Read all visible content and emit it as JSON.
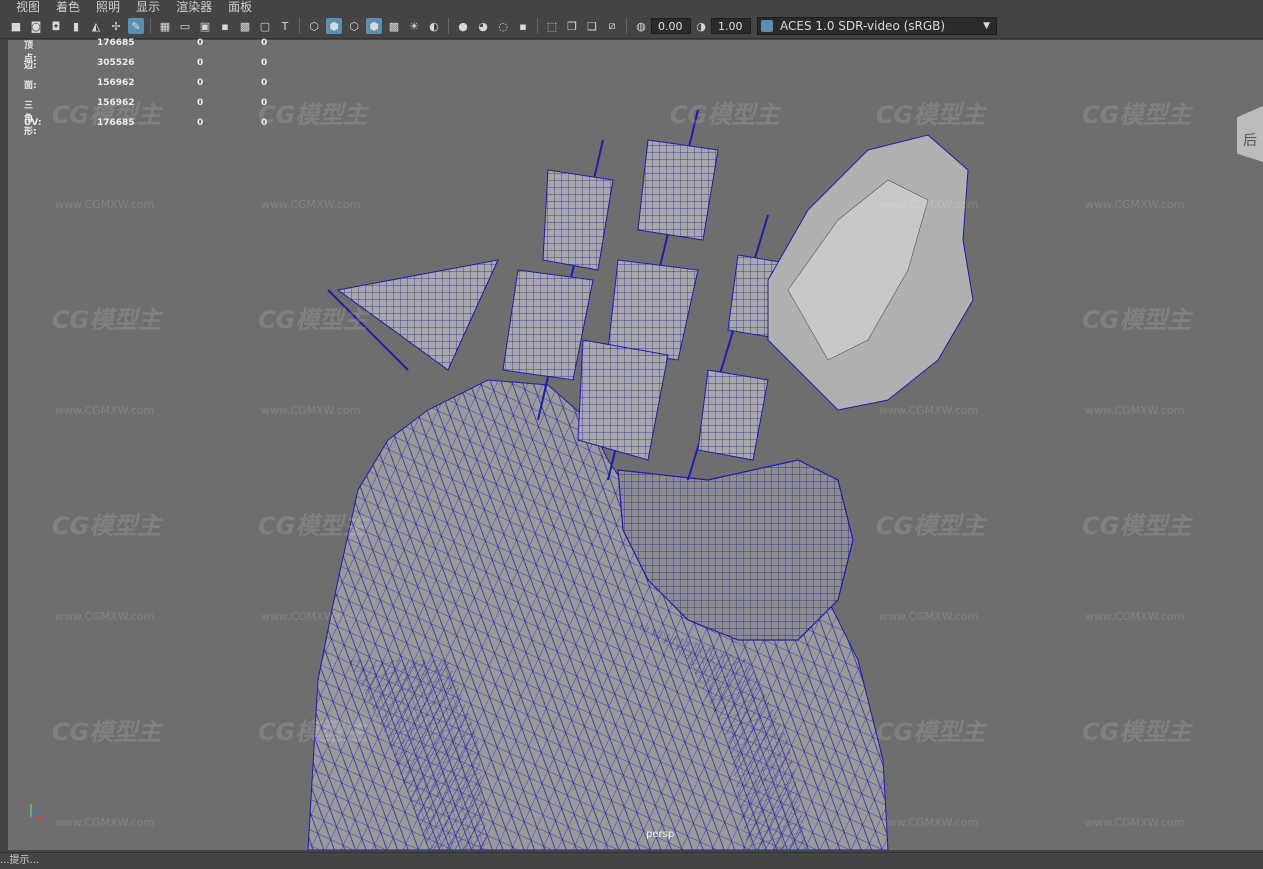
{
  "menu": [
    "视图",
    "着色",
    "照明",
    "显示",
    "渲染器",
    "面板"
  ],
  "toolbar": {
    "icons_group1": [
      "camera-icon",
      "camera-attr-icon",
      "bookmark-icon",
      "image-plane-icon",
      "grid-transform-icon",
      "pencil-icon"
    ],
    "icons_group2": [
      "grid-icon",
      "film-gate-icon",
      "resolution-gate-icon",
      "gate-mask-icon",
      "field-chart-icon",
      "safe-action-icon",
      "safe-title-icon"
    ],
    "icons_group3": [
      "wireframe-icon",
      "smooth-shade-icon",
      "wireframe-on-shaded-icon",
      "xray-icon",
      "textured-icon",
      "lighting-icon",
      "shadows-icon"
    ],
    "icons_group4": [
      "ambient-occlusion-icon",
      "motion-blur-icon",
      "multisample-icon",
      "depth-of-field-icon"
    ],
    "icons_group5": [
      "isolate-select-icon",
      "xray-joints-icon",
      "xray-active-icon",
      "backface-icon"
    ],
    "exposure_value": "0.00",
    "gamma_value": "1.00",
    "color_space": "ACES 1.0 SDR-video (sRGB)"
  },
  "hud": {
    "rows": [
      {
        "label": "顶点:",
        "v1": "176685",
        "v2": "0",
        "v3": "0"
      },
      {
        "label": "边:",
        "v1": "305526",
        "v2": "0",
        "v3": "0"
      },
      {
        "label": "面:",
        "v1": "156962",
        "v2": "0",
        "v3": "0"
      },
      {
        "label": "三角形:",
        "v1": "156962",
        "v2": "0",
        "v3": "0"
      },
      {
        "label": "UV:",
        "v1": "176685",
        "v2": "0",
        "v3": "0"
      }
    ]
  },
  "camera_label": "persp",
  "viewcube_label": "后",
  "watermark": {
    "logo": "CG模型主",
    "url": "www.CGMXW.com"
  },
  "statusbar": {
    "text": "...提示..."
  },
  "colors": {
    "background": "#444444",
    "viewport": "#6e6e6e",
    "wire": "#1a1aa0",
    "accent": "#5a8fb0"
  }
}
